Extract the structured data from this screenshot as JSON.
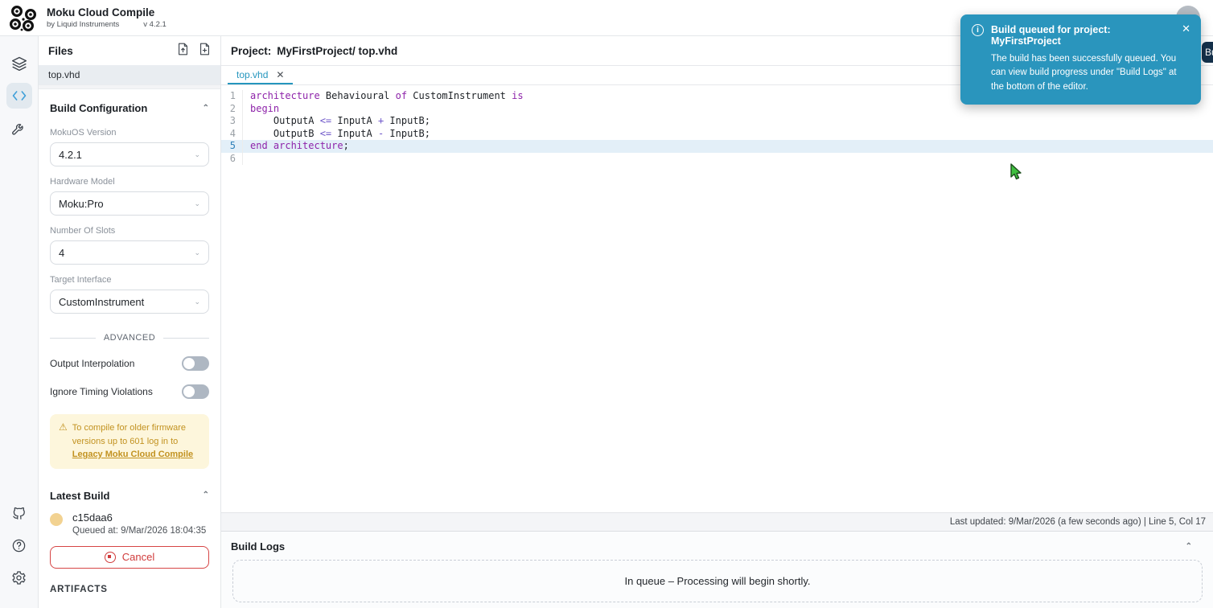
{
  "app": {
    "title": "Moku Cloud Compile",
    "byline": "by Liquid Instruments",
    "version": "v 4.2.1"
  },
  "icon_rail": {
    "items": [
      "layers",
      "code-editor",
      "wrench",
      "github",
      "help",
      "settings"
    ],
    "active": "code-editor"
  },
  "files_panel": {
    "header": "Files",
    "action_icons": [
      "upload-file-icon",
      "new-file-icon"
    ],
    "files": [
      {
        "name": "top.vhd",
        "selected": true
      }
    ]
  },
  "build_config": {
    "header": "Build Configuration",
    "fields": [
      {
        "label": "MokuOS Version",
        "value": "4.2.1"
      },
      {
        "label": "Hardware Model",
        "value": "Moku:Pro"
      },
      {
        "label": "Number Of Slots",
        "value": "4"
      },
      {
        "label": "Target Interface",
        "value": "CustomInstrument"
      }
    ],
    "advanced_label": "ADVANCED",
    "toggles": [
      {
        "label": "Output Interpolation",
        "on": false
      },
      {
        "label": "Ignore Timing Violations",
        "on": false
      }
    ],
    "warning": {
      "text_before": "To compile for older firmware versions up to 601 log in to ",
      "link_text": "Legacy Moku Cloud Compile"
    }
  },
  "latest_build": {
    "header": "Latest Build",
    "hash": "c15daa6",
    "queued_at": "Queued at: 9/Mar/2026 18:04:35",
    "cancel_label": "Cancel",
    "status_color": "#f2d291"
  },
  "artifacts_label": "ARTIFACTS",
  "editor": {
    "project_label": "Project:",
    "project_path": "MyFirstProject/ top.vhd",
    "tab_label": "top.vhd",
    "status_right": "Last updated: 9/Mar/2026 (a few seconds ago) | Line 5, Col 17",
    "code": {
      "language": "vhdl",
      "lines": [
        {
          "n": 1,
          "active": false,
          "tokens": [
            [
              "kw",
              "architecture"
            ],
            [
              "id",
              " Behavioural "
            ],
            [
              "kw",
              "of"
            ],
            [
              "id",
              " CustomInstrument "
            ],
            [
              "kw",
              "is"
            ]
          ]
        },
        {
          "n": 2,
          "active": false,
          "tokens": [
            [
              "kw",
              "begin"
            ]
          ]
        },
        {
          "n": 3,
          "active": false,
          "tokens": [
            [
              "id",
              "    OutputA "
            ],
            [
              "op",
              "<="
            ],
            [
              "id",
              " InputA "
            ],
            [
              "op",
              "+"
            ],
            [
              "id",
              " InputB;"
            ]
          ]
        },
        {
          "n": 4,
          "active": false,
          "tokens": [
            [
              "id",
              "    OutputB "
            ],
            [
              "op",
              "<="
            ],
            [
              "id",
              " InputA "
            ],
            [
              "op",
              "-"
            ],
            [
              "id",
              " InputB;"
            ]
          ]
        },
        {
          "n": 5,
          "active": true,
          "tokens": [
            [
              "kw",
              "end architecture"
            ],
            [
              "id",
              ";"
            ]
          ]
        },
        {
          "n": 6,
          "active": false,
          "tokens": []
        }
      ]
    }
  },
  "build_logs": {
    "header": "Build Logs",
    "message": "In queue – Processing will begin shortly."
  },
  "toast": {
    "title": "Build queued for project: MyFirstProject",
    "body": "The build has been successfully queued. You can view build progress under \"Build Logs\" at the bottom of the editor.",
    "accent": "#2a95bd"
  },
  "header_action": {
    "visible_label": "Build"
  }
}
